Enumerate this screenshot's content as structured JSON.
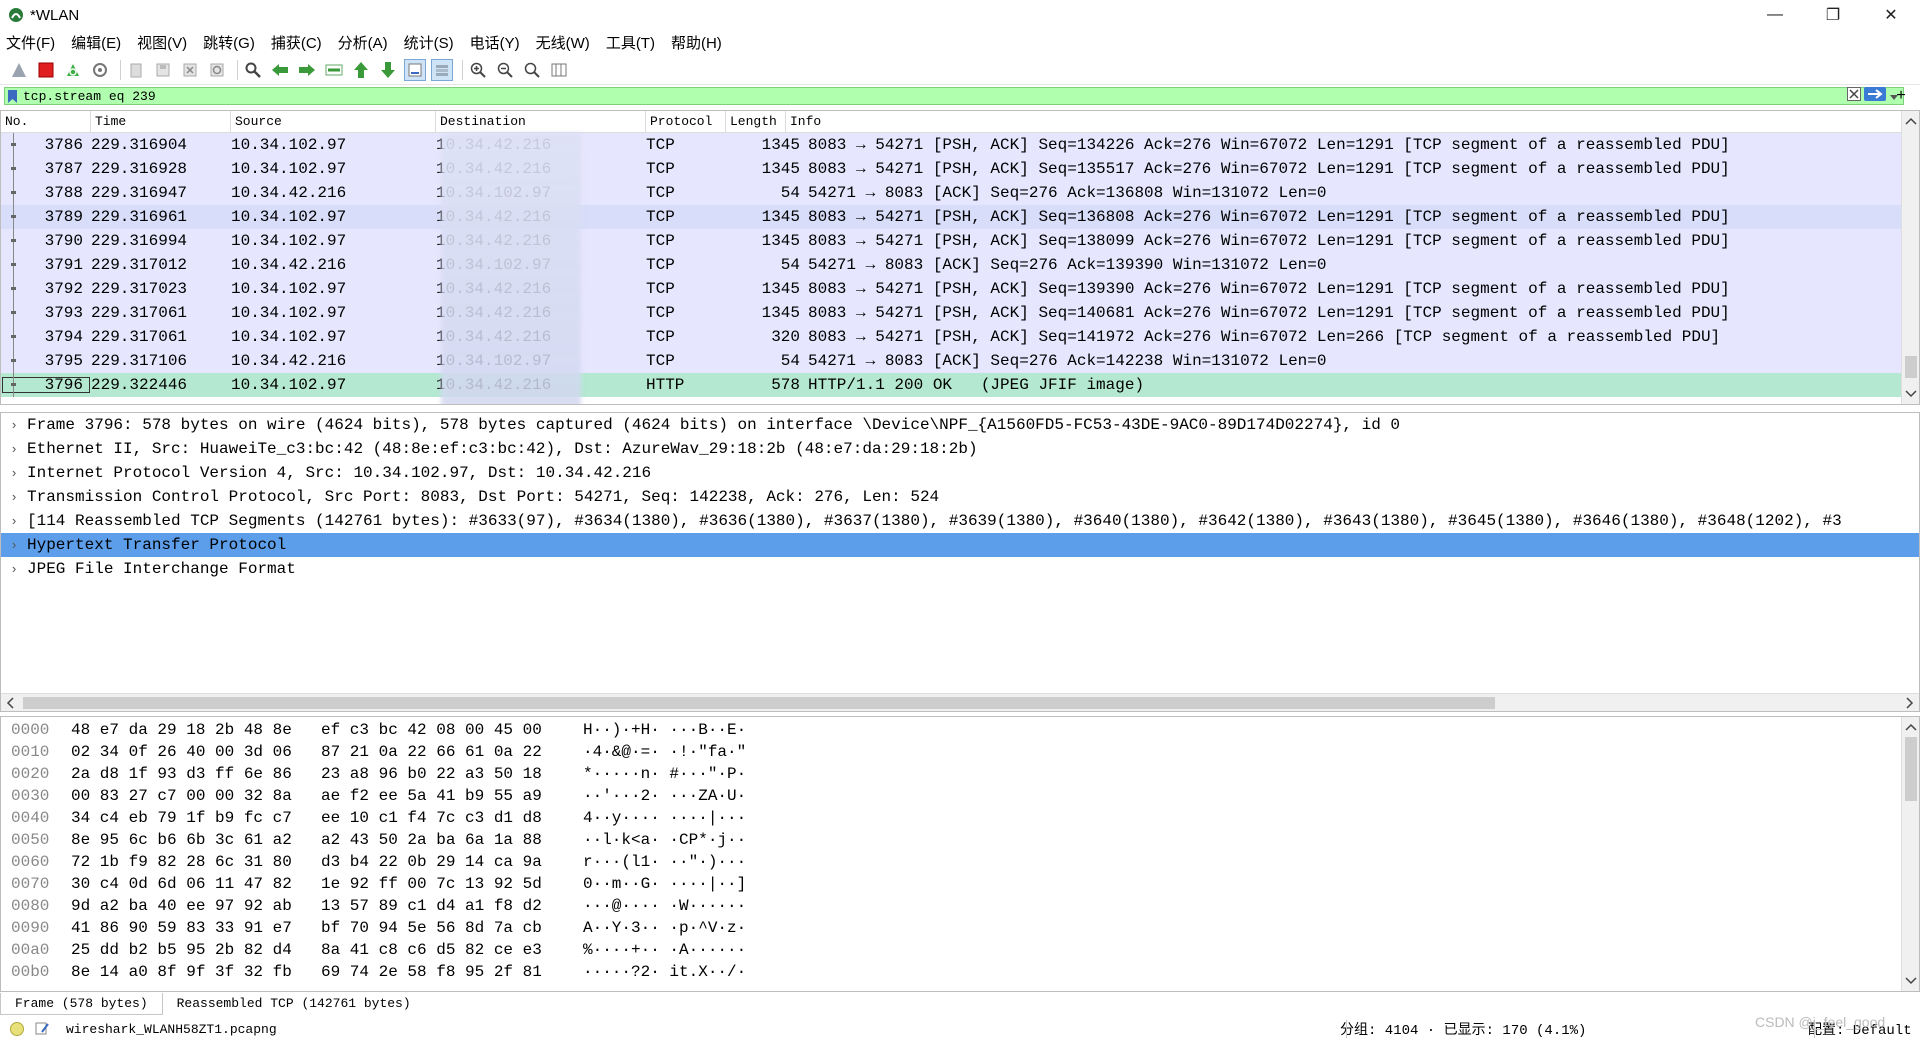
{
  "window": {
    "title": "*WLAN",
    "minimize": "—",
    "restore": "❐",
    "close": "✕"
  },
  "menu": [
    "文件(F)",
    "编辑(E)",
    "视图(V)",
    "跳转(G)",
    "捕获(C)",
    "分析(A)",
    "统计(S)",
    "电话(Y)",
    "无线(W)",
    "工具(T)",
    "帮助(H)"
  ],
  "toolbar": {
    "icons": [
      "shark-fin-start-icon",
      "stop-icon",
      "restart-icon",
      "capture-options-icon",
      "open-file-icon",
      "save-file-icon",
      "close-file-icon",
      "reload-icon",
      "find-packet-icon",
      "go-back-icon",
      "go-forward-icon",
      "go-to-packet-icon",
      "first-packet-icon",
      "last-packet-icon",
      "auto-scroll-icon",
      "colorize-icon",
      "zoom-in-icon",
      "zoom-out-icon",
      "normal-size-icon",
      "resize-columns-icon"
    ]
  },
  "filter": {
    "value": "tcp.stream eq 239",
    "plus": "+"
  },
  "packet_list": {
    "columns": [
      "No.",
      "Time",
      "Source",
      "Destination",
      "Protocol",
      "Length",
      "Info"
    ],
    "rows": [
      {
        "no": "3786",
        "time": "229.316904",
        "src": "10.34.102.97",
        "dst": "10.34.42.216",
        "proto": "TCP",
        "len": "1345",
        "info": "8083 → 54271 [PSH, ACK] Seq=134226 Ack=276 Win=67072 Len=1291 [TCP segment of a reassembled PDU]",
        "kind": "tcp"
      },
      {
        "no": "3787",
        "time": "229.316928",
        "src": "10.34.102.97",
        "dst": "10.34.42.216",
        "proto": "TCP",
        "len": "1345",
        "info": "8083 → 54271 [PSH, ACK] Seq=135517 Ack=276 Win=67072 Len=1291 [TCP segment of a reassembled PDU]",
        "kind": "tcp"
      },
      {
        "no": "3788",
        "time": "229.316947",
        "src": "10.34.42.216",
        "dst": "10.34.102.97",
        "proto": "TCP",
        "len": "54",
        "info": "54271 → 8083 [ACK] Seq=276 Ack=136808 Win=131072 Len=0",
        "kind": "tcp"
      },
      {
        "no": "3789",
        "time": "229.316961",
        "src": "10.34.102.97",
        "dst": "10.34.42.216",
        "proto": "TCP",
        "len": "1345",
        "info": "8083 → 54271 [PSH, ACK] Seq=136808 Ack=276 Win=67072 Len=1291 [TCP segment of a reassembled PDU]",
        "kind": "sel"
      },
      {
        "no": "3790",
        "time": "229.316994",
        "src": "10.34.102.97",
        "dst": "10.34.42.216",
        "proto": "TCP",
        "len": "1345",
        "info": "8083 → 54271 [PSH, ACK] Seq=138099 Ack=276 Win=67072 Len=1291 [TCP segment of a reassembled PDU]",
        "kind": "tcp"
      },
      {
        "no": "3791",
        "time": "229.317012",
        "src": "10.34.42.216",
        "dst": "10.34.102.97",
        "proto": "TCP",
        "len": "54",
        "info": "54271 → 8083 [ACK] Seq=276 Ack=139390 Win=131072 Len=0",
        "kind": "tcp"
      },
      {
        "no": "3792",
        "time": "229.317023",
        "src": "10.34.102.97",
        "dst": "10.34.42.216",
        "proto": "TCP",
        "len": "1345",
        "info": "8083 → 54271 [PSH, ACK] Seq=139390 Ack=276 Win=67072 Len=1291 [TCP segment of a reassembled PDU]",
        "kind": "tcp"
      },
      {
        "no": "3793",
        "time": "229.317061",
        "src": "10.34.102.97",
        "dst": "10.34.42.216",
        "proto": "TCP",
        "len": "1345",
        "info": "8083 → 54271 [PSH, ACK] Seq=140681 Ack=276 Win=67072 Len=1291 [TCP segment of a reassembled PDU]",
        "kind": "tcp"
      },
      {
        "no": "3794",
        "time": "229.317061",
        "src": "10.34.102.97",
        "dst": "10.34.42.216",
        "proto": "TCP",
        "len": "320",
        "info": "8083 → 54271 [PSH, ACK] Seq=141972 Ack=276 Win=67072 Len=266 [TCP segment of a reassembled PDU]",
        "kind": "tcp"
      },
      {
        "no": "3795",
        "time": "229.317106",
        "src": "10.34.42.216",
        "dst": "10.34.102.97",
        "proto": "TCP",
        "len": "54",
        "info": "54271 → 8083 [ACK] Seq=276 Ack=142238 Win=131072 Len=0",
        "kind": "tcp"
      },
      {
        "no": "3796",
        "time": "229.322446",
        "src": "10.34.102.97",
        "dst": "10.34.42.216",
        "proto": "HTTP",
        "len": "578",
        "info": "HTTP/1.1 200 OK   (JPEG JFIF image)",
        "kind": "http"
      }
    ]
  },
  "details": {
    "rows": [
      "Frame 3796: 578 bytes on wire (4624 bits), 578 bytes captured (4624 bits) on interface \\Device\\NPF_{A1560FD5-FC53-43DE-9AC0-89D174D02274}, id 0",
      "Ethernet II, Src: HuaweiTe_c3:bc:42 (48:8e:ef:c3:bc:42), Dst: AzureWav_29:18:2b (48:e7:da:29:18:2b)",
      "Internet Protocol Version 4, Src: 10.34.102.97, Dst: 10.34.42.216",
      "Transmission Control Protocol, Src Port: 8083, Dst Port: 54271, Seq: 142238, Ack: 276, Len: 524",
      "[114 Reassembled TCP Segments (142761 bytes): #3633(97), #3634(1380), #3636(1380), #3637(1380), #3639(1380), #3640(1380), #3642(1380), #3643(1380), #3645(1380), #3646(1380), #3648(1202), #3",
      "Hypertext Transfer Protocol",
      "JPEG File Interchange Format"
    ],
    "selected_index": 5
  },
  "bytes": {
    "rows": [
      {
        "off": "0000",
        "h1": "48 e7 da 29 18 2b 48 8e",
        "h2": "ef c3 bc 42 08 00 45 00",
        "ascii": "H··)·+H· ···B··E·"
      },
      {
        "off": "0010",
        "h1": "02 34 0f 26 40 00 3d 06",
        "h2": "87 21 0a 22 66 61 0a 22",
        "ascii": "·4·&@·=· ·!·\"fa·\""
      },
      {
        "off": "0020",
        "h1": "2a d8 1f 93 d3 ff 6e 86",
        "h2": "23 a8 96 b0 22 a3 50 18",
        "ascii": "*·····n· #···\"·P·"
      },
      {
        "off": "0030",
        "h1": "00 83 27 c7 00 00 32 8a",
        "h2": "ae f2 ee 5a 41 b9 55 a9",
        "ascii": "··'···2· ···ZA·U·"
      },
      {
        "off": "0040",
        "h1": "34 c4 eb 79 1f b9 fc c7",
        "h2": "ee 10 c1 f4 7c c3 d1 d8",
        "ascii": "4··y···· ····|···"
      },
      {
        "off": "0050",
        "h1": "8e 95 6c b6 6b 3c 61 a2",
        "h2": "a2 43 50 2a ba 6a 1a 88",
        "ascii": "··l·k<a· ·CP*·j··"
      },
      {
        "off": "0060",
        "h1": "72 1b f9 82 28 6c 31 80",
        "h2": "d3 b4 22 0b 29 14 ca 9a",
        "ascii": "r···(l1· ··\"·)···"
      },
      {
        "off": "0070",
        "h1": "30 c4 0d 6d 06 11 47 82",
        "h2": "1e 92 ff 00 7c 13 92 5d",
        "ascii": "0··m··G· ····|··]"
      },
      {
        "off": "0080",
        "h1": "9d a2 ba 40 ee 97 92 ab",
        "h2": "13 57 89 c1 d4 a1 f8 d2",
        "ascii": "···@···· ·W······"
      },
      {
        "off": "0090",
        "h1": "41 86 90 59 83 33 91 e7",
        "h2": "bf 70 94 5e 56 8d 7a cb",
        "ascii": "A··Y·3·· ·p·^V·z·"
      },
      {
        "off": "00a0",
        "h1": "25 dd b2 b5 95 2b 82 d4",
        "h2": "8a 41 c8 c6 d5 82 ce e3",
        "ascii": "%····+·· ·A······"
      },
      {
        "off": "00b0",
        "h1": "8e 14 a0 8f 9f 3f 32 fb",
        "h2": "69 74 2e 58 f8 95 2f 81",
        "ascii": "·····?2· it.X··/·"
      }
    ]
  },
  "byte_tabs": [
    "Frame (578 bytes)",
    "Reassembled TCP (142761 bytes)"
  ],
  "status": {
    "file": "wireshark_WLANH58ZT1.pcapng",
    "stats": "分组: 4104 · 已显示: 170 (4.1%)",
    "profile": "配置: Default",
    "watermark": "CSDN @i_feel_good"
  },
  "colors": {
    "filter_bg": "#afffaf",
    "tcp_row": "#e7e6ff",
    "http_row": "#b5e8d1",
    "selected_detail": "#5c9ee9"
  }
}
